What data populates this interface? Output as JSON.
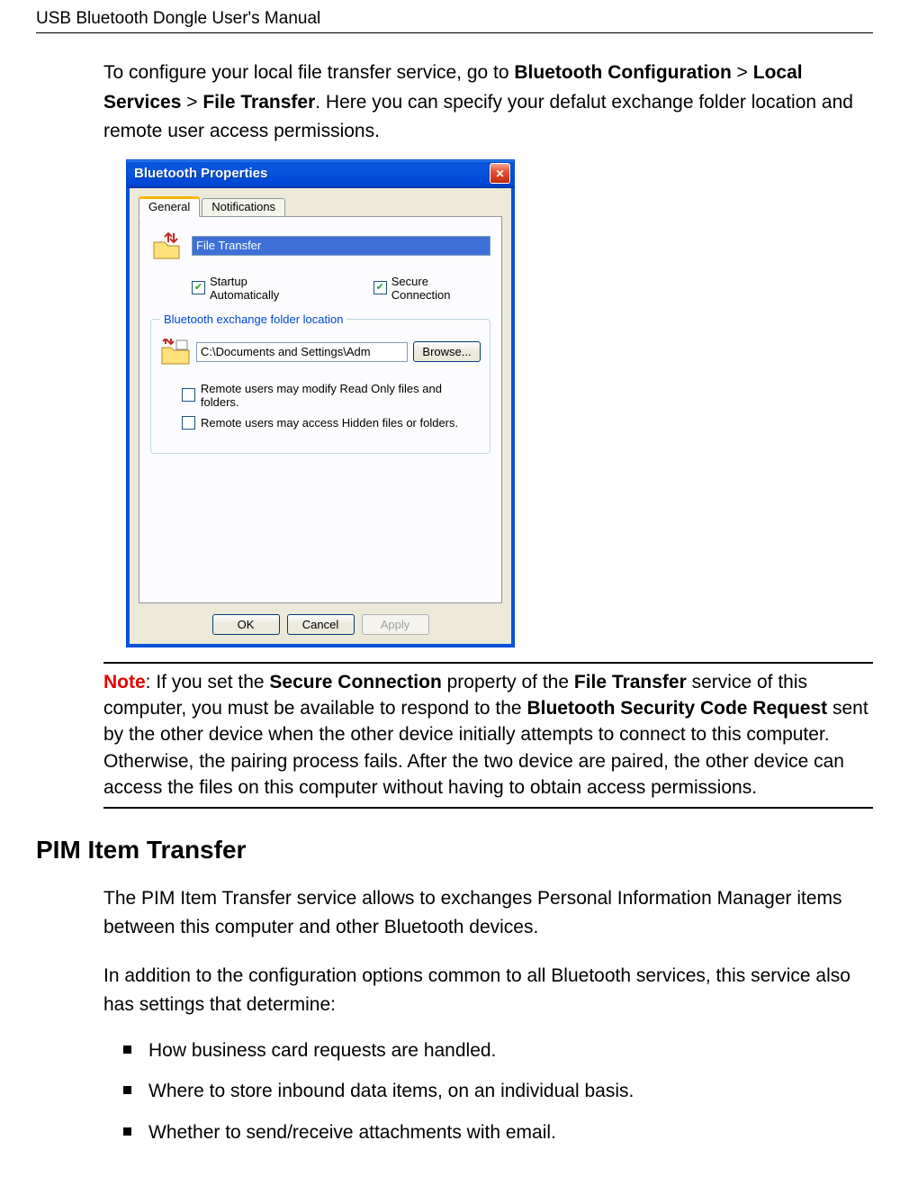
{
  "header": "USB Bluetooth Dongle User's Manual",
  "intro": {
    "pre": "To configure your local file transfer service, go to ",
    "path1": "Bluetooth Configuration",
    "gt1": " > ",
    "path2": "Local Services",
    "gt2": " > ",
    "path3": "File Transfer",
    "post": ". Here you can specify your defalut exchange folder location and remote user access permissions."
  },
  "dialog": {
    "title": "Bluetooth Properties",
    "tabs": {
      "general": "General",
      "notifications": "Notifications"
    },
    "service_name": "File Transfer",
    "startup_label": "Startup Automatically",
    "secure_label": "Secure Connection",
    "group_legend": "Bluetooth exchange folder location",
    "folder_path": "C:\\Documents and Settings\\Adm",
    "browse": "Browse...",
    "perm1": "Remote users may modify Read Only files and folders.",
    "perm2": "Remote users may access Hidden files or folders.",
    "ok": "OK",
    "cancel": "Cancel",
    "apply": "Apply"
  },
  "note": {
    "label": "Note",
    "t1": ": If you set the ",
    "b1": "Secure Connection",
    "t2": " property of the ",
    "b2": "File Transfer",
    "t3": " service of this computer, you must be available to respond to the ",
    "b3": "Bluetooth Security Code Request",
    "t4": " sent by the other device when the other device initially attempts to connect to this computer. Otherwise, the pairing process fails. After the two device are paired, the other device can access the files on this computer without having to obtain access permissions."
  },
  "section_heading": "PIM Item Transfer",
  "pim": {
    "p1": "The PIM Item Transfer service allows to exchanges Personal Information Manager items between this computer and other Bluetooth devices.",
    "p2": "In addition to the configuration options common to all Bluetooth services, this service also has settings that determine:",
    "bullets": [
      "How business card requests are handled.",
      "Where to store inbound data items, on an individual basis.",
      "Whether to send/receive attachments with email."
    ]
  }
}
